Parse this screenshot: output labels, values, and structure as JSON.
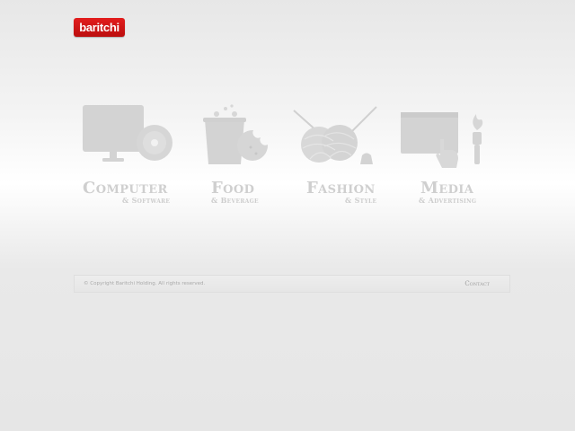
{
  "brand": {
    "logo_text": "baritchi",
    "logo_color": "#d51818"
  },
  "categories": [
    {
      "title": "Computer",
      "subtitle": "& Software",
      "icon": "computer-cd-icon"
    },
    {
      "title": "Food",
      "subtitle": "& Beverage",
      "icon": "food-bucket-icon"
    },
    {
      "title": "Fashion",
      "subtitle": "& Style",
      "icon": "yarn-needles-icon"
    },
    {
      "title": "Media",
      "subtitle": "& Advertising",
      "icon": "billboard-brush-icon"
    }
  ],
  "footer": {
    "copyright": "© Copyright Baritchi Holding. All rights reserved.",
    "contact_label": "Contact"
  },
  "colors": {
    "icon_gray": "#d3d3d3",
    "text_gray": "#cfcfcf"
  }
}
